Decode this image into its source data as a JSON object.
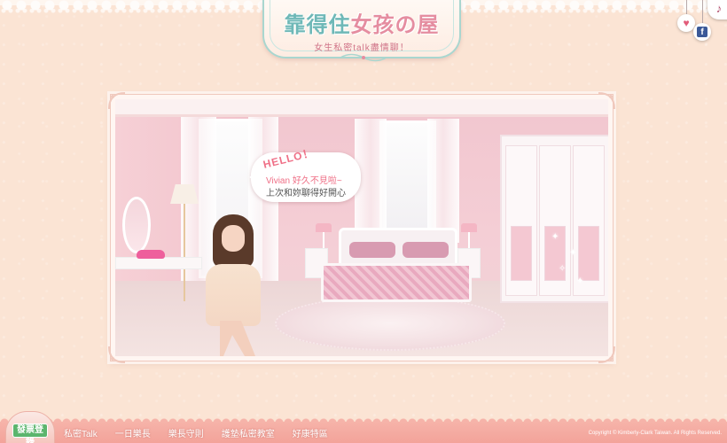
{
  "header": {
    "logo_title_part1": "靠得住",
    "logo_title_part2": "女孩の屋",
    "logo_subtitle": "女生私密talk盡情聊！"
  },
  "top_icons": {
    "music": "music-note-icon",
    "heart": "heart-icon",
    "facebook": "facebook-icon",
    "facebook_letter": "f"
  },
  "scene": {
    "bubble_hello": "HELLO！",
    "bubble_line1": "Vivian 好久不見啦~",
    "bubble_line2": "上次和妳聊得好開心"
  },
  "footer": {
    "register_label": "發票登錄",
    "nav": [
      "私密Talk",
      "一日樂長",
      "樂長守則",
      "護墊私密教室",
      "好康特區"
    ],
    "copyright": "Copyright © Kimberly-Clark Taiwan. All Rights Reserved."
  },
  "colors": {
    "background": "#fbe4d4",
    "accent_pink": "#ef6f86",
    "footer_band": "#f3a39a",
    "register_green": "#5bb56d",
    "logo_teal": "#6fb8b7"
  }
}
